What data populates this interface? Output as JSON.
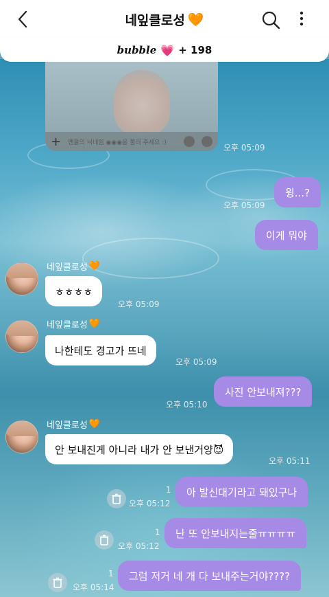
{
  "header": {
    "title": "네잎클로성",
    "title_emoji": "🧡",
    "back_icon": "chevron-left-icon",
    "search_icon": "search-icon",
    "more_icon": "more-vertical-icon"
  },
  "subbar": {
    "brand": "bubble",
    "heart": "💗",
    "count": "+ 198"
  },
  "image_message": {
    "placeholder": "팬들의 닉네임 ◉◉◉을 불러 주세요 :)",
    "time": "오후 05:09"
  },
  "messages": [
    {
      "dir": "out",
      "text": "윙...?",
      "time": "오후 05:09"
    },
    {
      "dir": "out",
      "text": "이게 뭐야",
      "time": ""
    },
    {
      "dir": "in",
      "sender": "네잎클로성",
      "sender_emoji": "🧡",
      "text": "ㅎㅎㅎㅎ",
      "time": "오후 05:09"
    },
    {
      "dir": "in",
      "sender": "네잎클로성",
      "sender_emoji": "🧡",
      "text": "나한테도 경고가 뜨네",
      "time": "오후 05:09"
    },
    {
      "dir": "out",
      "text": "사진 안보내져???",
      "time": "오후 05:10"
    },
    {
      "dir": "in",
      "sender": "네잎클로성",
      "sender_emoji": "🧡",
      "text": "안 보내진게 아니라 내가 안 보낸거양😈",
      "time": "오후 05:11"
    },
    {
      "dir": "out",
      "text": "아 발신대기라고 돼있구나",
      "time": "오후 05:12",
      "read": "1"
    },
    {
      "dir": "out",
      "text": "난 또 안보내지는줄ㅠㅠㅠㅠ",
      "time": "오후 05:12",
      "read": "1"
    },
    {
      "dir": "out",
      "text": "그럼 저거 네 개 다 보내주는거야????",
      "time": "오후 05:14",
      "read": "1"
    }
  ],
  "colors": {
    "out_bubble": "#a58ae6",
    "in_bubble": "#ffffff",
    "header_bg": "#ffffff"
  }
}
